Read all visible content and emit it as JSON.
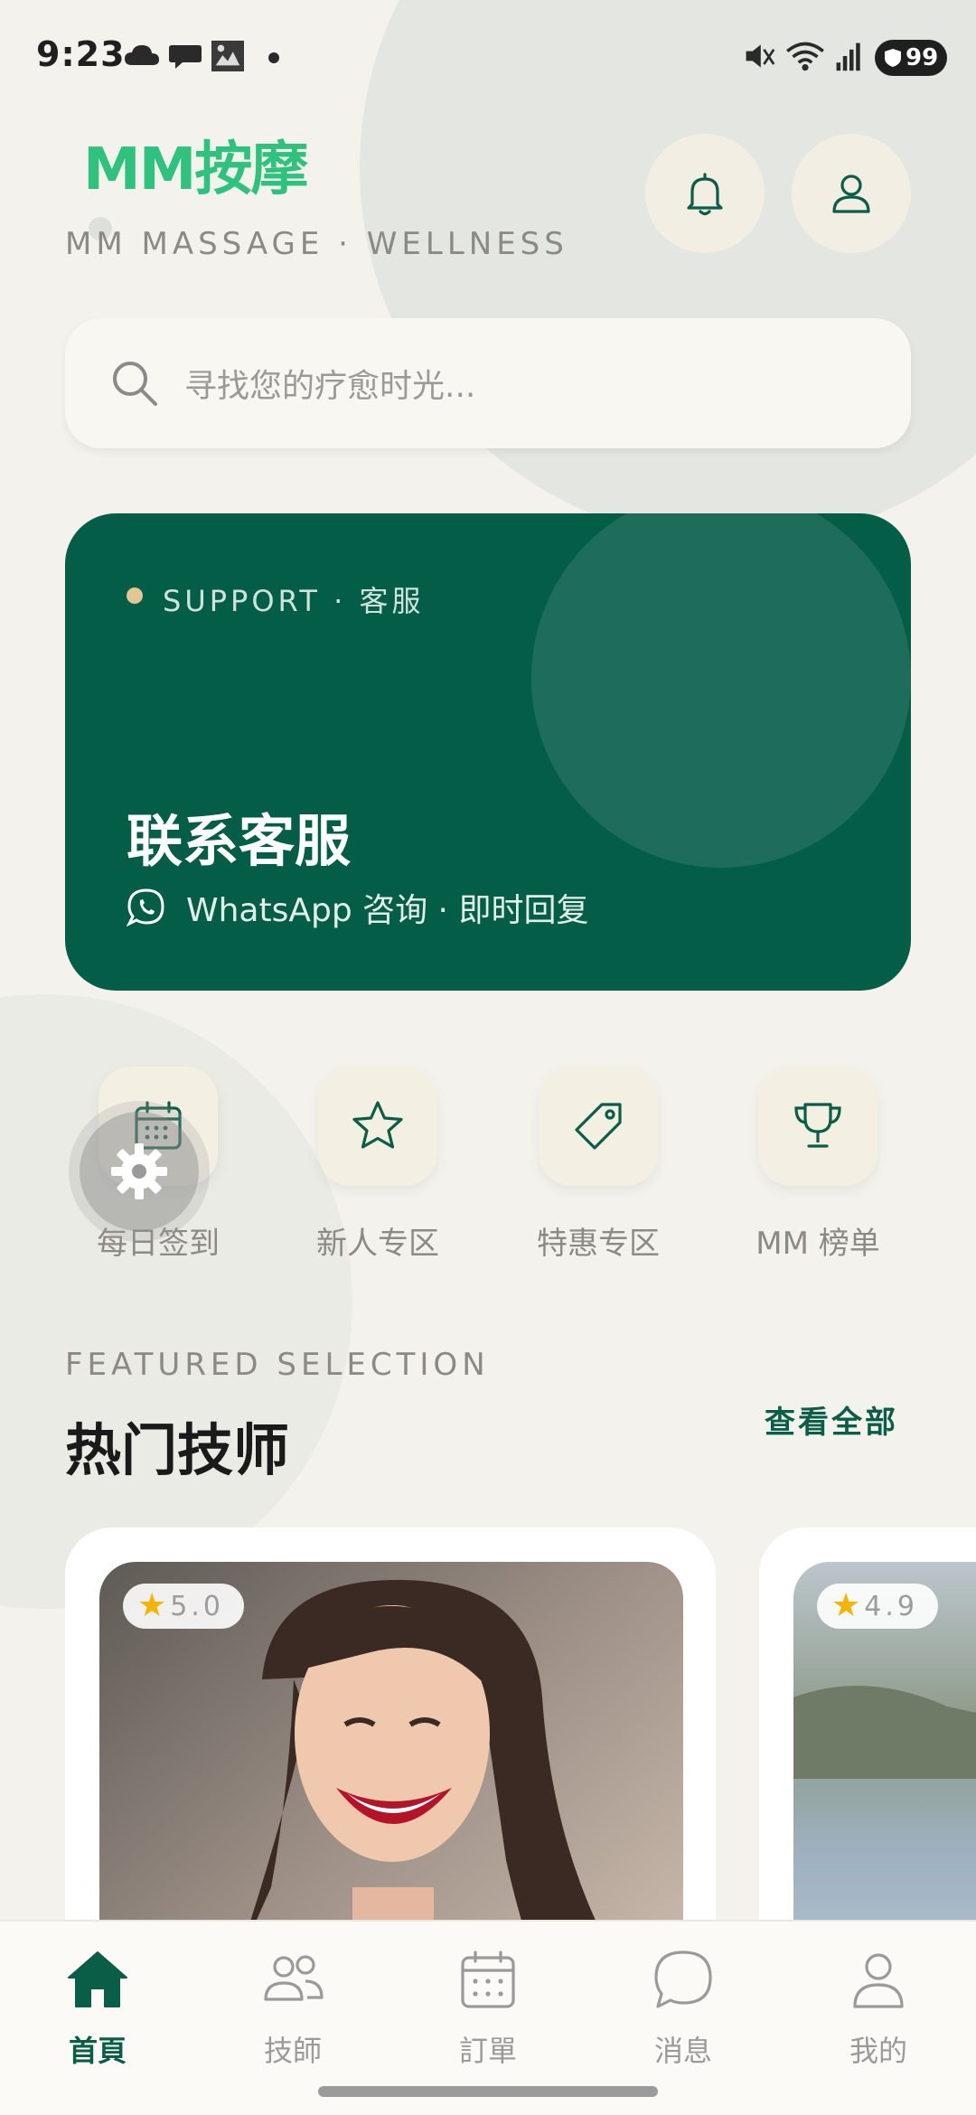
{
  "status_bar": {
    "time": "9:23",
    "battery": "99"
  },
  "header": {
    "logo": "MM按摩",
    "tagline": "MM MASSAGE · WELLNESS"
  },
  "search": {
    "placeholder": "寻找您的疗愈时光..."
  },
  "support": {
    "tag": "SUPPORT · 客服",
    "title": "联系客服",
    "subtitle": "WhatsApp 咨询 · 即时回复"
  },
  "quick_actions": [
    {
      "label": "每日签到",
      "icon": "calendar-icon"
    },
    {
      "label": "新人专区",
      "icon": "star-icon"
    },
    {
      "label": "特惠专区",
      "icon": "tag-icon"
    },
    {
      "label": "MM 榜单",
      "icon": "trophy-icon"
    }
  ],
  "featured": {
    "overline": "FEATURED SELECTION",
    "title": "热门技师",
    "view_all": "查看全部"
  },
  "therapists": [
    {
      "rating": "5.0"
    },
    {
      "rating": "4.9"
    }
  ],
  "bottom_nav": [
    {
      "label": "首頁",
      "icon": "home-icon",
      "active": true
    },
    {
      "label": "技師",
      "icon": "users-icon",
      "active": false
    },
    {
      "label": "訂單",
      "icon": "calendar-icon",
      "active": false
    },
    {
      "label": "消息",
      "icon": "chat-icon",
      "active": false
    },
    {
      "label": "我的",
      "icon": "user-icon",
      "active": false
    }
  ],
  "colors": {
    "brand_green": "#045e47",
    "logo_green": "#2ec27e",
    "background": "#f4f2ed",
    "star": "#f5b400"
  }
}
